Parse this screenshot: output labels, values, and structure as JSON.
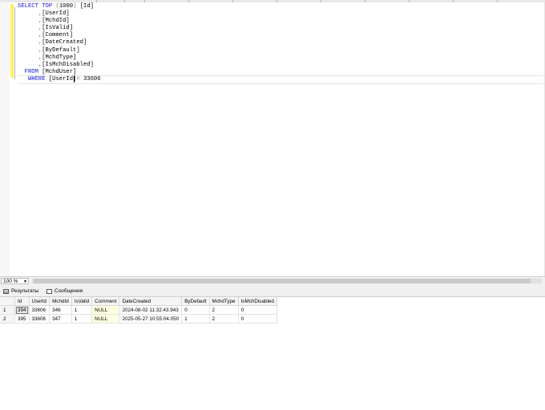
{
  "editor": {
    "lines": [
      {
        "parts": [
          {
            "t": "SELECT",
            "c": "kw"
          },
          {
            "t": " ",
            "c": "tx"
          },
          {
            "t": "TOP",
            "c": "kw"
          },
          {
            "t": " (",
            "c": "op"
          },
          {
            "t": "1000",
            "c": "num"
          },
          {
            "t": ")",
            "c": "op"
          },
          {
            "t": " [Id]",
            "c": "tx"
          }
        ]
      },
      {
        "parts": [
          {
            "t": "      ,",
            "c": "op"
          },
          {
            "t": "[UserId]",
            "c": "tx"
          }
        ]
      },
      {
        "parts": [
          {
            "t": "      ,",
            "c": "op"
          },
          {
            "t": "[MchdId]",
            "c": "tx"
          }
        ]
      },
      {
        "parts": [
          {
            "t": "      ,",
            "c": "op"
          },
          {
            "t": "[IsValid]",
            "c": "tx"
          }
        ]
      },
      {
        "parts": [
          {
            "t": "      ,",
            "c": "op"
          },
          {
            "t": "[Comment]",
            "c": "tx"
          }
        ]
      },
      {
        "parts": [
          {
            "t": "      ,",
            "c": "op"
          },
          {
            "t": "[DateCreated]",
            "c": "tx"
          }
        ]
      },
      {
        "parts": [
          {
            "t": "      ,",
            "c": "op"
          },
          {
            "t": "[ByDefault]",
            "c": "tx"
          }
        ]
      },
      {
        "parts": [
          {
            "t": "      ,",
            "c": "op"
          },
          {
            "t": "[MchdType]",
            "c": "tx"
          }
        ]
      },
      {
        "parts": [
          {
            "t": "      ,",
            "c": "op"
          },
          {
            "t": "[IsMchDisabled]",
            "c": "tx"
          }
        ]
      },
      {
        "parts": [
          {
            "t": "  FROM",
            "c": "kw"
          },
          {
            "t": " [MchdUser]",
            "c": "tx"
          }
        ]
      },
      {
        "parts": [
          {
            "t": "   WHERE",
            "c": "kw"
          },
          {
            "t": " [UserId]",
            "c": "tx"
          },
          {
            "t": "= ",
            "c": "op"
          },
          {
            "t": "33606",
            "c": "num"
          }
        ]
      }
    ]
  },
  "zoom": {
    "value": "100 %"
  },
  "tabs": {
    "results": "Результаты",
    "messages": "Сообщения"
  },
  "grid": {
    "columns": [
      "Id",
      "UserId",
      "MchdId",
      "IsValid",
      "Comment",
      "DateCreated",
      "ByDefault",
      "MchdType",
      "IsMchDisabled"
    ],
    "rows": [
      {
        "num": "1",
        "cells": [
          "394",
          "33606",
          "346",
          "1",
          "NULL",
          "2024-08-02 11:32:43.943",
          "0",
          "2",
          "0"
        ]
      },
      {
        "num": "2",
        "cells": [
          "395",
          "33606",
          "347",
          "1",
          "NULL",
          "2025-05-27 10:55:04.050",
          "1",
          "2",
          "0"
        ]
      }
    ]
  }
}
